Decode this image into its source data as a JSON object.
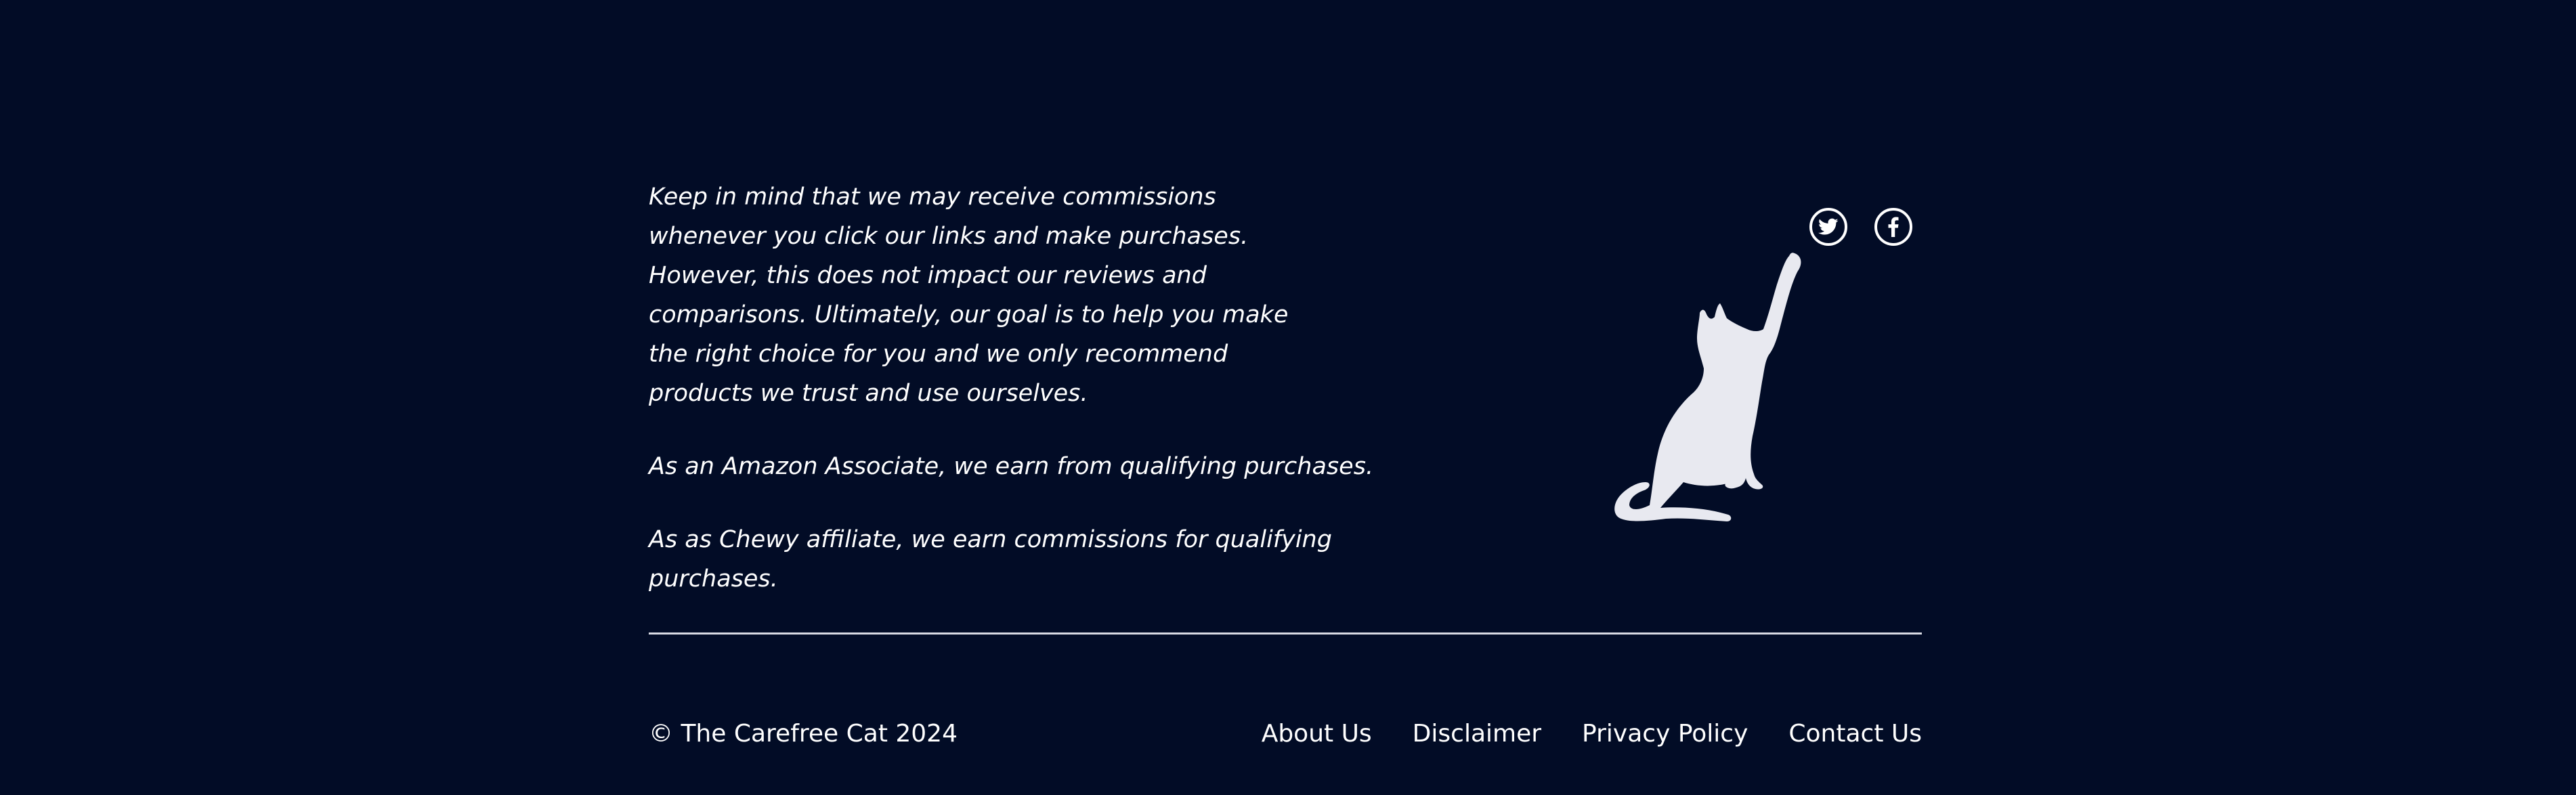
{
  "colors": {
    "background": "#020c26",
    "text": "#ffffff",
    "cat": "#e8e9f0",
    "divider": "#d9dbe3"
  },
  "disclaimer": {
    "commission_text": "Keep in mind that we may receive commissions whenever you click our links and make purchases. However, this does not impact our reviews and comparisons. Ultimately, our goal is to help you make the right choice for you and we only recommend products we trust and use ourselves.",
    "amazon_text": "As an Amazon Associate, we earn from qualifying purchases.",
    "chewy_text": "As as Chewy affiliate, we earn commissions for qualifying purchases."
  },
  "social": {
    "items": [
      {
        "icon": "twitter-icon",
        "label": "Twitter"
      },
      {
        "icon": "facebook-icon",
        "label": "Facebook"
      }
    ]
  },
  "illustration": {
    "icon": "cat-silhouette"
  },
  "footer": {
    "copyright": "© The Carefree Cat 2024",
    "links": [
      {
        "label": "About Us"
      },
      {
        "label": "Disclaimer"
      },
      {
        "label": "Privacy Policy"
      },
      {
        "label": "Contact Us"
      }
    ]
  }
}
